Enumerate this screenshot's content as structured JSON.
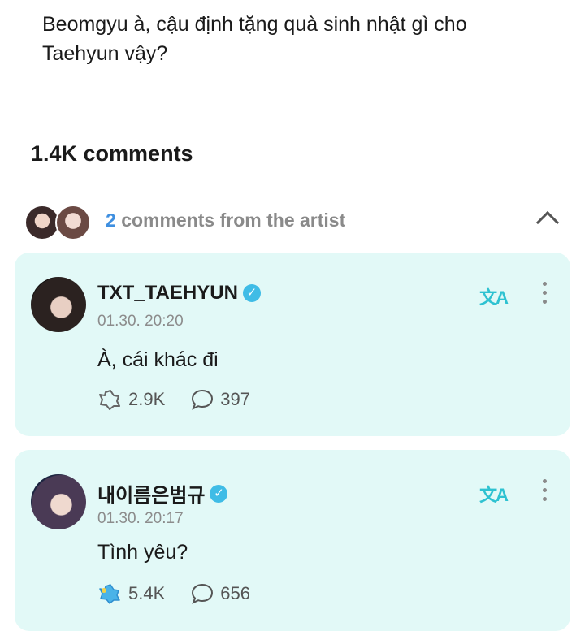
{
  "question": {
    "text": "Beomgyu à, cậu định tặng quà sinh nhật gì cho Taehyun vậy?"
  },
  "comments_count": "1.4K comments",
  "artist_section": {
    "count": "2",
    "label": "comments from the artist"
  },
  "comments": [
    {
      "username": "TXT_TAEHYUN",
      "timestamp": "01.30. 20:20",
      "text": "À, cái khác đi",
      "likes": "2.9K",
      "replies": "397",
      "liked": false
    },
    {
      "username": "내이름은범규",
      "timestamp": "01.30. 20:17",
      "text": "Tình yêu?",
      "likes": "5.4K",
      "replies": "656",
      "liked": true
    }
  ],
  "icons": {
    "translate": "文A",
    "verified": "✓"
  },
  "colors": {
    "card_bg": "#e2f9f7",
    "accent": "#2ec2d1",
    "count_blue": "#3f8fe0",
    "verified": "#3fbce6"
  }
}
